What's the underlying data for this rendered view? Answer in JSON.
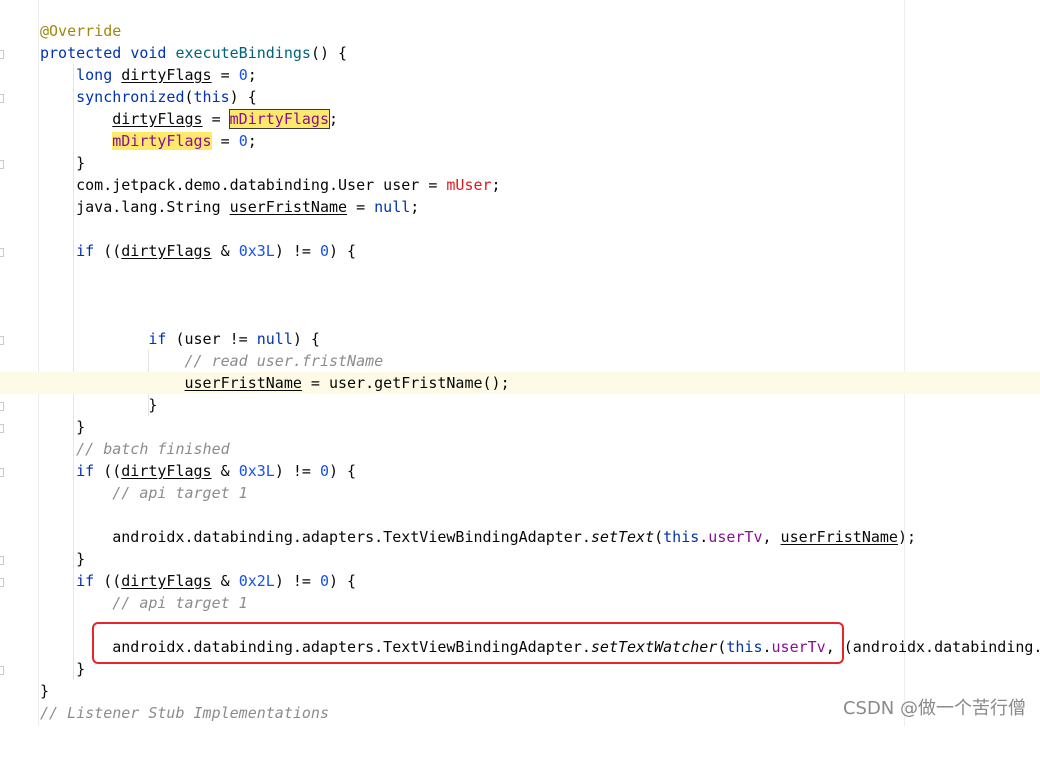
{
  "editor": {
    "lines": {
      "l01": {
        "annotation": "@Override"
      },
      "l02": {
        "kw_protected": "protected",
        "kw_void": "void",
        "method": "executeBindings",
        "rest": "() {"
      },
      "l03": {
        "kw_long": "long",
        "var": "dirtyFlags",
        "eq": " = ",
        "zero": "0",
        "end": ";"
      },
      "l04": {
        "kw_sync": "synchronized",
        "paren_open": "(",
        "kw_this": "this",
        "rest": ") {"
      },
      "l05": {
        "var": "dirtyFlags",
        "eq": " = ",
        "field": "mDirtyFlags",
        "end": ";"
      },
      "l06": {
        "field": "mDirtyFlags",
        "eq": " = ",
        "zero": "0",
        "end": ";"
      },
      "l07": {
        "text": "}"
      },
      "l08": {
        "type": "com.jetpack.demo.databinding.User user = ",
        "field": "mUser",
        "end": ";"
      },
      "l09": {
        "type": "java.lang.String ",
        "var": "userFristName",
        "eq": " = ",
        "kw_null": "null",
        "end": ";"
      },
      "l10": {
        "kw_if": "if",
        "open": " ((",
        "var": "dirtyFlags",
        "op": " & ",
        "hex": "0x3L",
        "mid": ") != ",
        "zero": "0",
        "end": ") {"
      },
      "l11": {
        "kw_if": "if",
        "open": " (user != ",
        "kw_null": "null",
        "end": ") {"
      },
      "l12": {
        "comment": "// read user.fristName"
      },
      "l13": {
        "var": "userFristName",
        "rest": " = user.getFristName();"
      },
      "l14": {
        "text": "}"
      },
      "l15": {
        "text": "}"
      },
      "l16": {
        "comment": "// batch finished"
      },
      "l17": {
        "kw_if": "if",
        "open": " ((",
        "var": "dirtyFlags",
        "op": " & ",
        "hex": "0x3L",
        "mid": ") != ",
        "zero": "0",
        "end": ") {"
      },
      "l18": {
        "comment": "// api target 1"
      },
      "l19": {
        "prefix": "androidx.databinding.adapters.TextViewBindingAdapter.",
        "method": "setText",
        "paren": "(",
        "kw_this": "this",
        "dot": ".",
        "field": "userTv",
        "comma": ", ",
        "var": "userFristName",
        "end": ");"
      },
      "l20": {
        "text": "}"
      },
      "l21": {
        "kw_if": "if",
        "open": " ((",
        "var": "dirtyFlags",
        "op": " & ",
        "hex": "0x2L",
        "mid": ") != ",
        "zero": "0",
        "end": ") {"
      },
      "l22": {
        "comment": "// api target 1"
      },
      "l23": {
        "prefix": "androidx.databinding.adapters.TextViewBindingAdapter.",
        "method": "setTextWatcher",
        "paren": "(",
        "kw_this": "this",
        "dot": ".",
        "field": "userTv",
        "comma": ", ",
        "rest": "(androidx.databinding."
      },
      "l24": {
        "text": "}"
      },
      "l25": {
        "text": "}"
      },
      "l26": {
        "comment": "// Listener Stub Implementations"
      }
    }
  },
  "watermark": "CSDN @做一个苦行僧",
  "colors": {
    "keyword": "#0033b3",
    "number": "#1750eb",
    "annotation": "#9e880d",
    "method": "#00627a",
    "field": "#871094",
    "highlight": "#ffe96b",
    "comment": "#8c8c8c",
    "red_field": "#e0191d",
    "red_box": "#e8242b",
    "current_line": "#fdfbe6"
  }
}
